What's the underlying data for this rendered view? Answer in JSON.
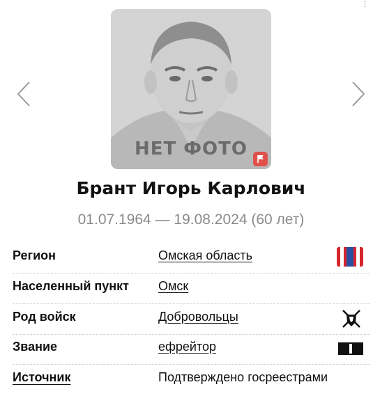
{
  "person": {
    "photo_placeholder": "НЕТ ФОТО",
    "name": "Брант Игорь Карлович",
    "dates": "01.07.1964 — 19.08.2024 (60 лет)"
  },
  "info": {
    "region": {
      "label": "Регион",
      "value": "Омская область",
      "icon": "region-flag-icon"
    },
    "settlement": {
      "label": "Населенный пункт",
      "value": "Омск"
    },
    "branch": {
      "label": "Род войск",
      "value": "Добровольцы",
      "icon": "volunteers-emblem-icon"
    },
    "rank": {
      "label": "Звание",
      "value": "ефрейтор",
      "icon": "rank-insignia-icon"
    },
    "source": {
      "label": "Источник",
      "value": "Подтверждено госреестрами"
    }
  },
  "colors": {
    "report_button": "#e0514b",
    "flag_red": "#d6252c",
    "flag_blue": "#2a4ea0"
  }
}
